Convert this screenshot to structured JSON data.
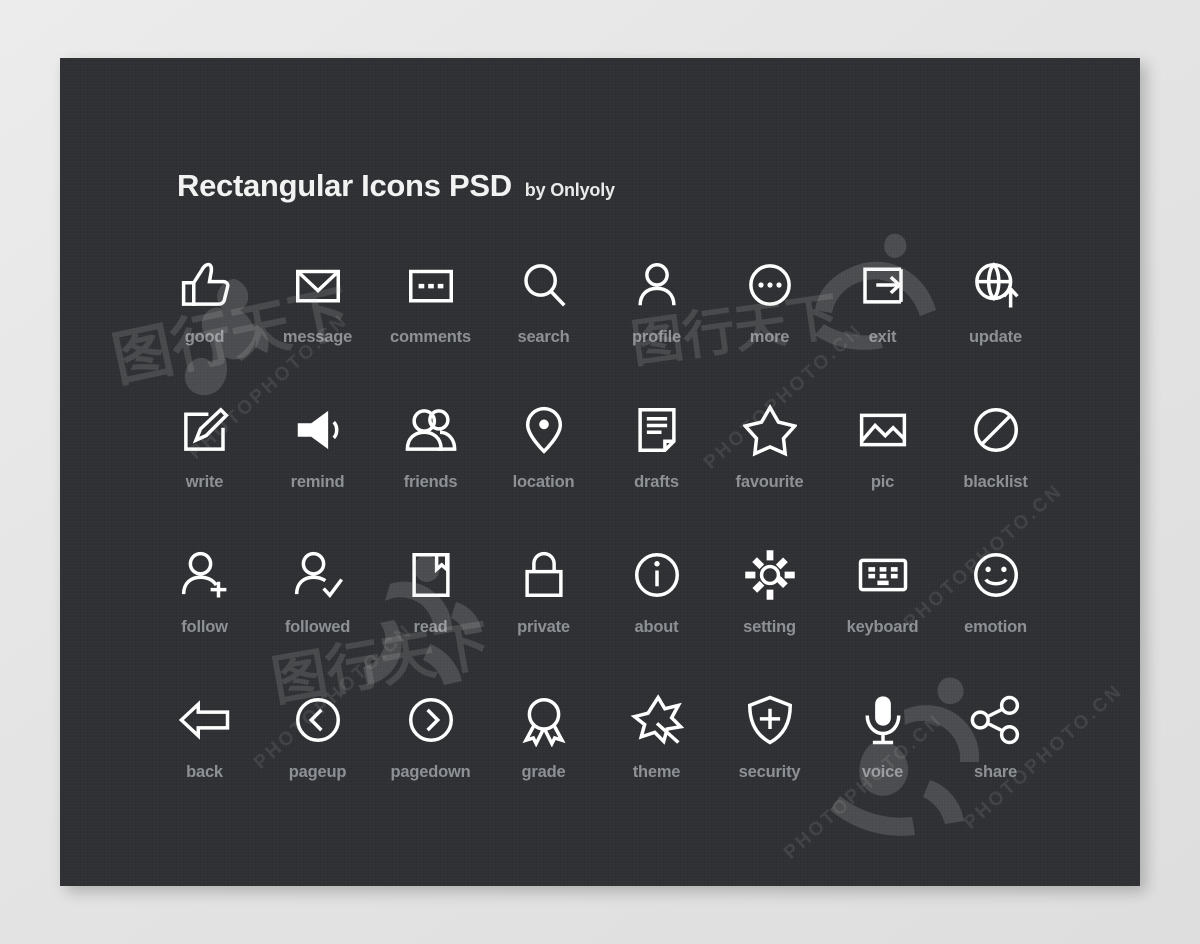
{
  "page": {
    "background_color": "#e6e6e6",
    "panel_color": "#2e3033",
    "icon_color": "#ffffff",
    "label_color": "#8d9095"
  },
  "header": {
    "title": "Rectangular Icons PSD",
    "byline": "by Onlyoly"
  },
  "grid": {
    "columns": 8,
    "rows": 4,
    "icons": [
      {
        "label": "good",
        "icon": "thumbs-up-icon"
      },
      {
        "label": "message",
        "icon": "envelope-icon"
      },
      {
        "label": "comments",
        "icon": "comment-box-icon"
      },
      {
        "label": "search",
        "icon": "magnifier-icon"
      },
      {
        "label": "profile",
        "icon": "person-icon"
      },
      {
        "label": "more",
        "icon": "ellipsis-circle-icon"
      },
      {
        "label": "exit",
        "icon": "exit-arrow-icon"
      },
      {
        "label": "update",
        "icon": "globe-up-arrow-icon"
      },
      {
        "label": "write",
        "icon": "pencil-square-icon"
      },
      {
        "label": "remind",
        "icon": "speaker-icon"
      },
      {
        "label": "friends",
        "icon": "two-people-icon"
      },
      {
        "label": "location",
        "icon": "map-pin-icon"
      },
      {
        "label": "drafts",
        "icon": "document-icon"
      },
      {
        "label": "favourite",
        "icon": "star-icon"
      },
      {
        "label": "pic",
        "icon": "picture-frame-icon"
      },
      {
        "label": "blacklist",
        "icon": "prohibition-icon"
      },
      {
        "label": "follow",
        "icon": "person-plus-icon"
      },
      {
        "label": "followed",
        "icon": "person-check-icon"
      },
      {
        "label": "read",
        "icon": "bookmark-page-icon"
      },
      {
        "label": "private",
        "icon": "padlock-icon"
      },
      {
        "label": "about",
        "icon": "info-circle-icon"
      },
      {
        "label": "setting",
        "icon": "gear-icon"
      },
      {
        "label": "keyboard",
        "icon": "keyboard-icon"
      },
      {
        "label": "emotion",
        "icon": "smiley-icon"
      },
      {
        "label": "back",
        "icon": "back-arrow-icon"
      },
      {
        "label": "pageup",
        "icon": "chevron-left-circle-icon"
      },
      {
        "label": "pagedown",
        "icon": "chevron-right-circle-icon"
      },
      {
        "label": "grade",
        "icon": "medal-icon"
      },
      {
        "label": "theme",
        "icon": "magic-wand-star-icon"
      },
      {
        "label": "security",
        "icon": "shield-plus-icon"
      },
      {
        "label": "voice",
        "icon": "microphone-icon"
      },
      {
        "label": "share",
        "icon": "share-nodes-icon"
      }
    ]
  },
  "watermarks": {
    "site": "PHOTOPHOTO.CN",
    "brand": "图行天下"
  }
}
